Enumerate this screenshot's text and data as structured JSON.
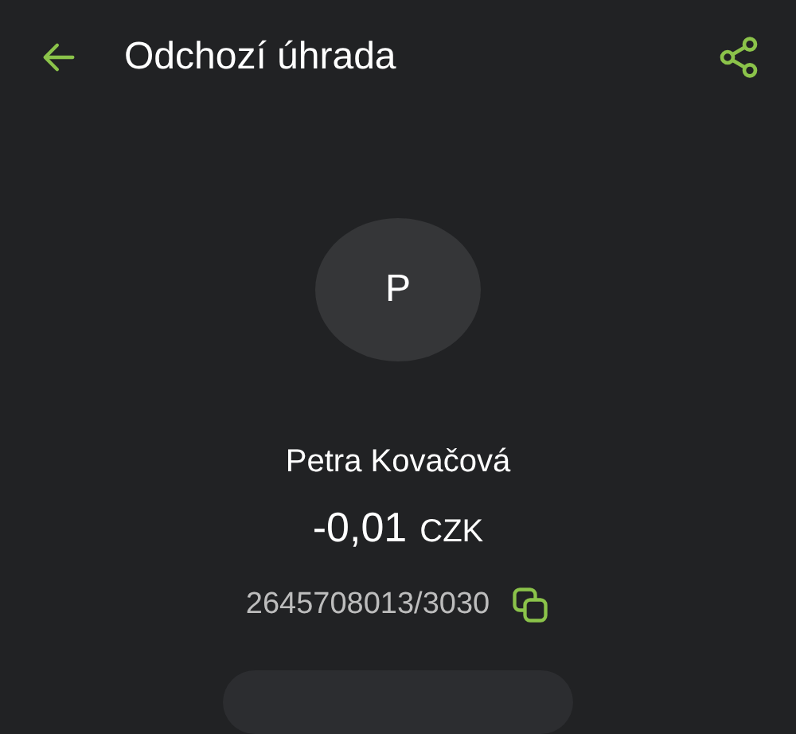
{
  "header": {
    "title": "Odchozí úhrada"
  },
  "avatar": {
    "initial": "P"
  },
  "name": "Petra Kovačová",
  "amount": {
    "value": "-0,01",
    "currency": "CZK"
  },
  "account": "2645708013/3030"
}
